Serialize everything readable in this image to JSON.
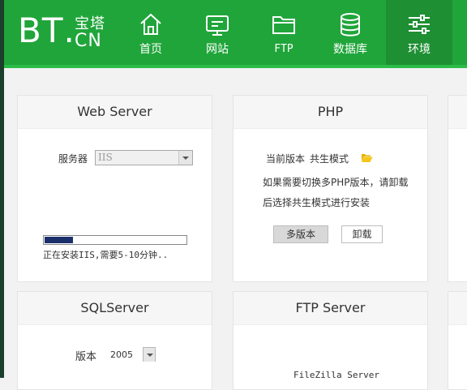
{
  "logo": {
    "main": "BT",
    "dot": ".",
    "sub_top": "宝塔",
    "sub_bottom": "CN"
  },
  "nav": [
    {
      "label": "首页",
      "icon": "home-icon"
    },
    {
      "label": "网站",
      "icon": "monitor-icon"
    },
    {
      "label": "FTP",
      "icon": "folder-icon"
    },
    {
      "label": "数据库",
      "icon": "database-icon"
    },
    {
      "label": "环境",
      "icon": "sliders-icon",
      "active": true
    }
  ],
  "cards": {
    "web_server": {
      "title": "Web Server",
      "server_label": "服务器",
      "server_value": "IIS",
      "progress": 0.2,
      "status": "正在安装IIS,需要5-10分钟.."
    },
    "php": {
      "title": "PHP",
      "version_label": "当前版本",
      "version_value": "共生模式",
      "desc_line1": "如果需要切换多PHP版本，请卸载",
      "desc_line2": "后选择共生模式进行安装",
      "multi_button": "多版本",
      "uninstall_button": "卸载"
    },
    "sql_server": {
      "title": "SQLServer",
      "version_label": "版本",
      "version_value": "2005"
    },
    "ftp_server": {
      "title": "FTP Server",
      "product": "FileZilla Server"
    }
  },
  "colors": {
    "header": "#20a53a",
    "active_tab": "#1e8f33",
    "progress": "#1b2f6b",
    "folder": "#e8b400"
  }
}
